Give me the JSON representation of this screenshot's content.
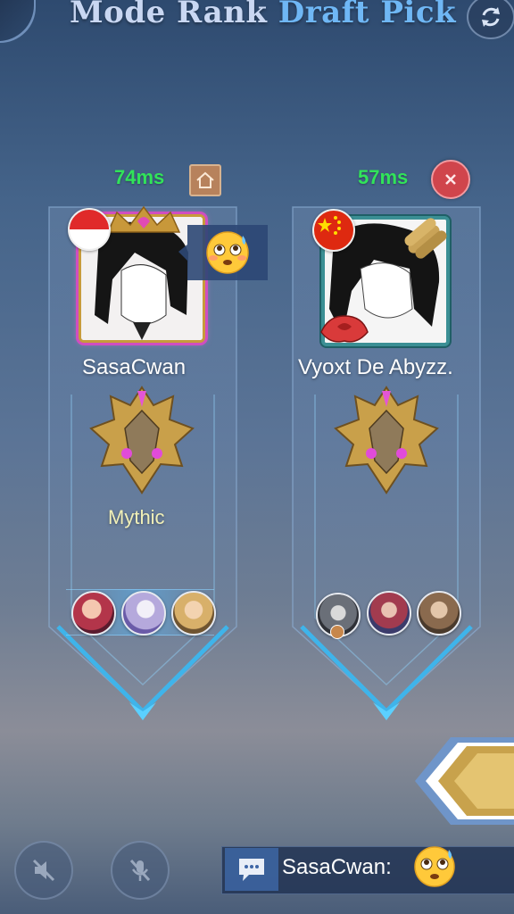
{
  "header": {
    "title_part1": "Mode Rank",
    "title_part2": "Draft Pick"
  },
  "players": [
    {
      "ping": "74ms",
      "name": "SasaCwan",
      "rank": "Mythic",
      "flag": "indonesia",
      "status_icon": "home-icon",
      "emoji": "flushed-face-emoji"
    },
    {
      "ping": "57ms",
      "name": "Vyoxt De Abyzz.",
      "rank": "",
      "flag": "china",
      "status_icon": "close-icon"
    }
  ],
  "chat": {
    "sender": "SasaCwan:",
    "emoji": "flushed-face-emoji"
  },
  "colors": {
    "ping": "#31e35a",
    "draft_title": "#6fb7f5",
    "mode_title": "#c9d7f2",
    "rank_text": "#f1f0b8"
  }
}
